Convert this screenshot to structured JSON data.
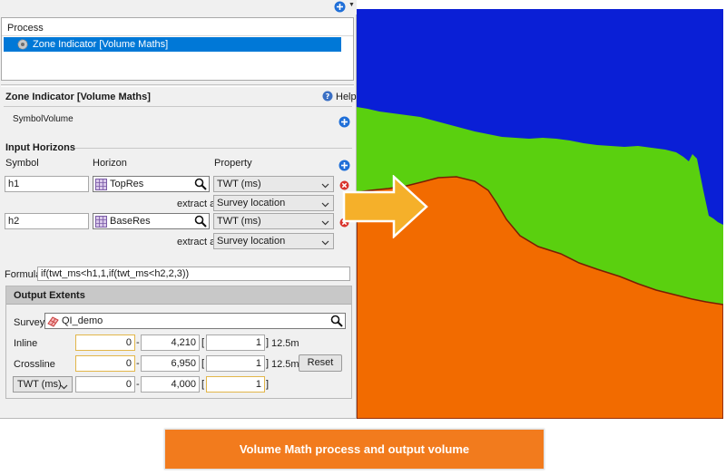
{
  "process": {
    "header": "Process",
    "items": [
      {
        "label": "Zone Indicator [Volume Maths]",
        "selected": true
      }
    ]
  },
  "zone_indicator": {
    "title": "Zone Indicator [Volume Maths]",
    "help_label": "Help",
    "symbol_volume_label": "SymbolVolume"
  },
  "input_horizons": {
    "title": "Input Horizons",
    "columns": {
      "symbol": "Symbol",
      "horizon": "Horizon",
      "property": "Property"
    },
    "extract_at_label": "extract at",
    "rows": [
      {
        "symbol": "h1",
        "horizon": "TopRes",
        "property": "TWT (ms)",
        "extract_at": "Survey location"
      },
      {
        "symbol": "h2",
        "horizon": "BaseRes",
        "property": "TWT (ms)",
        "extract_at": "Survey location"
      }
    ]
  },
  "formula": {
    "label": "Formula",
    "value": "if(twt_ms<h1,1,if(twt_ms<h2,2,3))"
  },
  "output_extents": {
    "title": "Output Extents",
    "survey_label": "Survey",
    "survey_value": "QI_demo",
    "inline": {
      "label": "Inline",
      "from": "0",
      "to": "4,210",
      "step": "1",
      "unit": "12.5m"
    },
    "crossline": {
      "label": "Crossline",
      "from": "0",
      "to": "6,950",
      "step": "1",
      "unit": "12.5m"
    },
    "twt": {
      "label": "TWT (ms)",
      "from": "0",
      "to": "4,000",
      "step": "1"
    },
    "reset_label": "Reset"
  },
  "caption": "Volume Math process and output volume",
  "colors": {
    "selection": "#0078d7",
    "zone_1": "#0a1fd6",
    "zone_2": "#5ad00f",
    "zone_3": "#f26b00",
    "arrow": "#f5b02a",
    "caption_bg": "#f27b1d",
    "add_icon": "#1f6fd8",
    "delete_icon": "#d9322b"
  }
}
